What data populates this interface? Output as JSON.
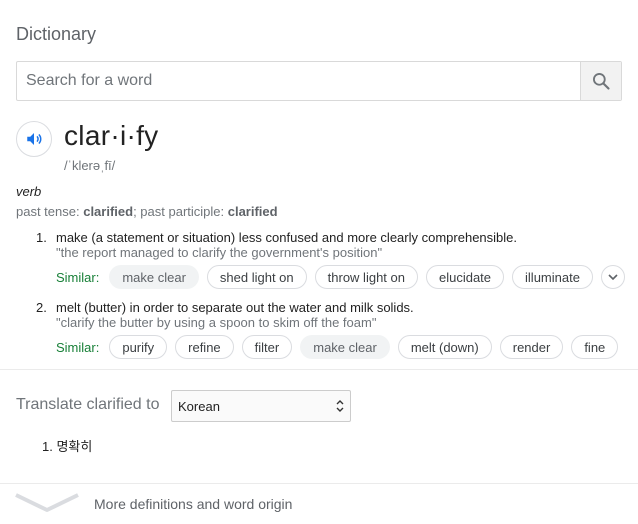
{
  "header": {
    "title": "Dictionary"
  },
  "search": {
    "placeholder": "Search for a word",
    "value": ""
  },
  "entry": {
    "word": "clar·i·fy",
    "phonetic": "/ˈklerəˌfī/",
    "part_of_speech": "verb",
    "forms": {
      "past_tense_label": "past tense: ",
      "past_tense": "clarified",
      "separator": "; past participle: ",
      "past_participle": "clarified"
    },
    "definitions": [
      {
        "number": "1.",
        "text": "make (a statement or situation) less confused and more clearly comprehensible.",
        "example": "\"the report managed to clarify the government's position\"",
        "similar_label": "Similar:",
        "similar": [
          "make clear",
          "shed light on",
          "throw light on",
          "elucidate",
          "illuminate"
        ]
      },
      {
        "number": "2.",
        "text": "melt (butter) in order to separate out the water and milk solids.",
        "example": "\"clarify the butter by using a spoon to skim off the foam\"",
        "similar_label": "Similar:",
        "similar": [
          "purify",
          "refine",
          "filter",
          "make clear",
          "melt (down)",
          "render",
          "fine"
        ]
      }
    ]
  },
  "translate": {
    "label": "Translate clarified to",
    "language": "Korean",
    "results": [
      {
        "number": "1.",
        "text": "명확히"
      }
    ]
  },
  "footer": {
    "more_label": "More definitions and word origin"
  },
  "colors": {
    "similar_label": "#188038",
    "speaker_icon": "#1a73e8",
    "muted_text": "#70757a"
  }
}
